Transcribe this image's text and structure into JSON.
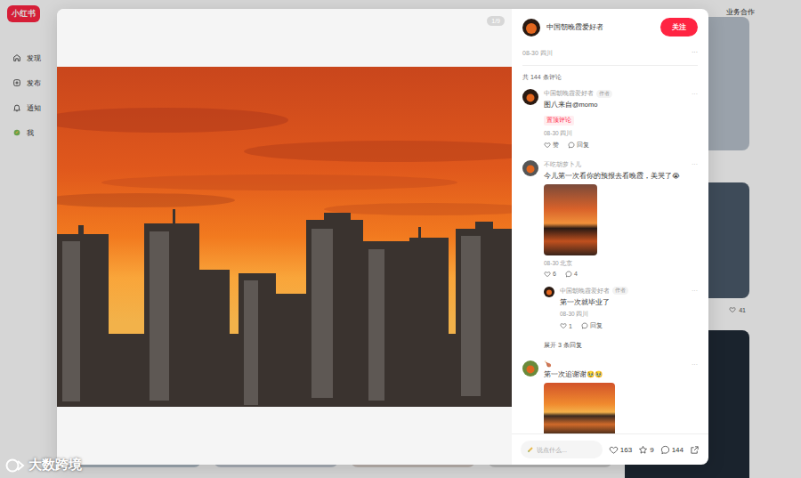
{
  "logo": "小红书",
  "sidebar": {
    "items": [
      {
        "label": "发现",
        "selected": false
      },
      {
        "label": "发布",
        "selected": false
      },
      {
        "label": "通知",
        "selected": false
      },
      {
        "label": "我",
        "selected": false
      }
    ]
  },
  "header": {
    "links": [
      "业务合作"
    ]
  },
  "feed": {
    "likes": "41"
  },
  "note": {
    "image_counter": "1/9",
    "author": "中国朝晚霞爱好者",
    "follow": "关注",
    "date": "08-30 四川",
    "menu": "···",
    "comment_total": "共 144 条评论"
  },
  "comments": [
    {
      "kind": "text",
      "author": "中国朝晚霞爱好者",
      "badge": "作者",
      "menu": "···",
      "text": "图八来自@momo",
      "tag": "置顶评论",
      "date": "08-30 四川",
      "like": "赞",
      "reply": "回复"
    },
    {
      "kind": "image",
      "author": "不吃胡萝卜儿",
      "menu": "···",
      "text": "今儿第一次看你的预报去看晚霞，美哭了😭",
      "date": "08-30 北京",
      "like": "6",
      "reply": "4",
      "replies": [
        {
          "author": "中国朝晚霞爱好者",
          "badge": "作者",
          "menu": "···",
          "text": "第一次就毕业了",
          "date": "08-30 四川",
          "like": "1",
          "reply": "回复"
        }
      ],
      "more": "展开 3 条回复"
    },
    {
      "kind": "image",
      "author": "🍗",
      "menu": "···",
      "text": "第一次追谢谢🥹🥹"
    }
  ],
  "footer": {
    "placeholder": "说点什么...",
    "likes": "163",
    "stars": "9",
    "comments": "144"
  },
  "watermark": "大数跨境"
}
